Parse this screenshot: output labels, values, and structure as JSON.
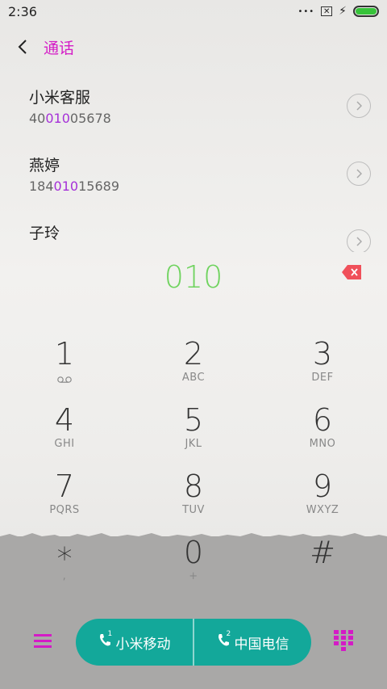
{
  "status": {
    "time": "2:36"
  },
  "header": {
    "title": "通话"
  },
  "contacts": [
    {
      "name": "小米客服",
      "num_pre": "40",
      "num_hl": "010",
      "num_post": "05678"
    },
    {
      "name": "燕婷",
      "num_pre": "184",
      "num_hl": "010",
      "num_post": "15689"
    },
    {
      "name": "子玲"
    }
  ],
  "dialer": {
    "input": "010"
  },
  "keys": [
    {
      "digit": "1",
      "sub": ""
    },
    {
      "digit": "2",
      "sub": "ABC"
    },
    {
      "digit": "3",
      "sub": "DEF"
    },
    {
      "digit": "4",
      "sub": "GHI"
    },
    {
      "digit": "5",
      "sub": "JKL"
    },
    {
      "digit": "6",
      "sub": "MNO"
    },
    {
      "digit": "7",
      "sub": "PQRS"
    },
    {
      "digit": "8",
      "sub": "TUV"
    },
    {
      "digit": "9",
      "sub": "WXYZ"
    },
    {
      "digit": "∗",
      "sub": ","
    },
    {
      "digit": "0",
      "sub": "+"
    },
    {
      "digit": "#",
      "sub": ""
    }
  ],
  "call": {
    "sim1_label": "小米移动",
    "sim1_index": "1",
    "sim2_label": "中国电信",
    "sim2_index": "2"
  },
  "colors": {
    "accent": "#d41bc6",
    "highlight": "#a530d8",
    "input": "#6fd35e",
    "call_button": "#13a89a",
    "delete": "#f0505a",
    "battery": "#37c33a"
  },
  "icons": {
    "back": "back-arrow-icon",
    "delete": "backspace-icon",
    "menu": "menu-icon",
    "keypad": "dialpad-icon",
    "voicemail": "voicemail-icon",
    "call": "phone-icon"
  }
}
